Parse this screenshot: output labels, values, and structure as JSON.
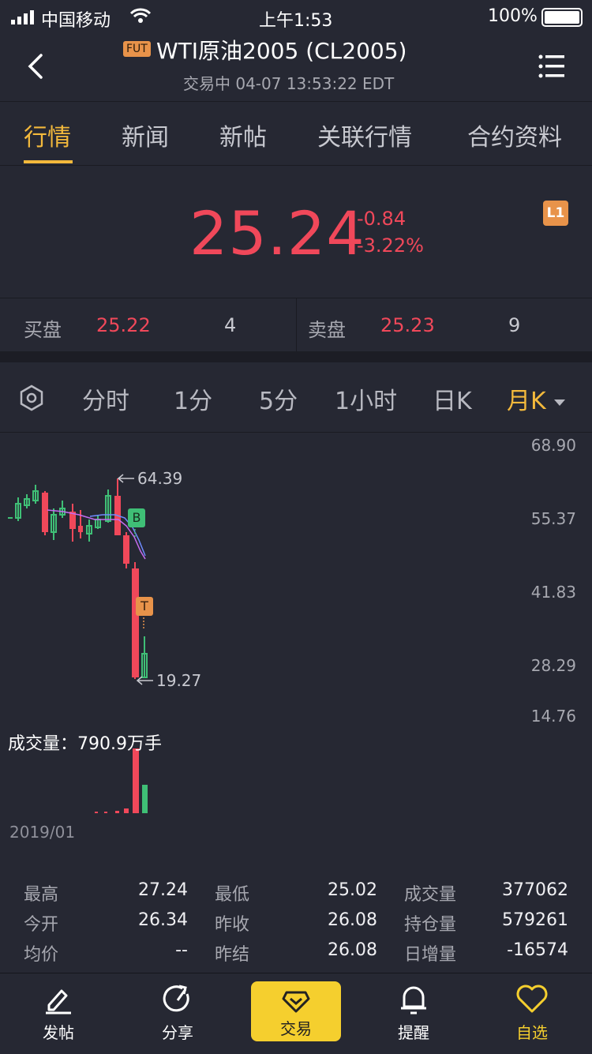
{
  "status_bar": {
    "carrier": "中国移动",
    "time": "上午1:53",
    "battery": "100%"
  },
  "header": {
    "badge": "FUT",
    "title": "WTI原油2005 (CL2005)",
    "subtitle": "交易中 04-07 13:53:22 EDT"
  },
  "tabs": [
    "行情",
    "新闻",
    "新帖",
    "关联行情",
    "合约资料"
  ],
  "quote": {
    "price": "25.24",
    "change": "-0.84",
    "change_pct": "-3.22%",
    "level_badge": "L1"
  },
  "bid": {
    "label": "买盘",
    "price": "25.22",
    "size": "4"
  },
  "ask": {
    "label": "卖盘",
    "price": "25.23",
    "size": "9"
  },
  "periods": [
    "分时",
    "1分",
    "5分",
    "1小时",
    "日K",
    "月K"
  ],
  "chart_data": {
    "type": "candlestick",
    "y_ticks": [
      "68.90",
      "55.37",
      "41.83",
      "28.29",
      "14.76"
    ],
    "high_marker": "64.39",
    "low_marker": "19.27",
    "markers": [
      "B",
      "T"
    ],
    "volume_label": "成交量：790.9万手",
    "x_start_label": "2019/01"
  },
  "stats": {
    "high_label": "最高",
    "high": "27.24",
    "low_label": "最低",
    "low": "25.02",
    "volume_label": "成交量",
    "volume": "377062",
    "open_label": "今开",
    "open": "26.34",
    "prev_close_label": "昨收",
    "prev_close": "26.08",
    "open_interest_label": "持仓量",
    "open_interest": "579261",
    "avg_label": "均价",
    "avg": "--",
    "prev_settle_label": "昨结",
    "prev_settle": "26.08",
    "oi_change_label": "日增量",
    "oi_change": "-16574"
  },
  "bottom_nav": [
    "发帖",
    "分享",
    "交易",
    "提醒",
    "自选"
  ],
  "colors": {
    "accent": "#f3b93c",
    "down": "#f0485a",
    "up": "#3fbf76",
    "bg": "#262833"
  }
}
